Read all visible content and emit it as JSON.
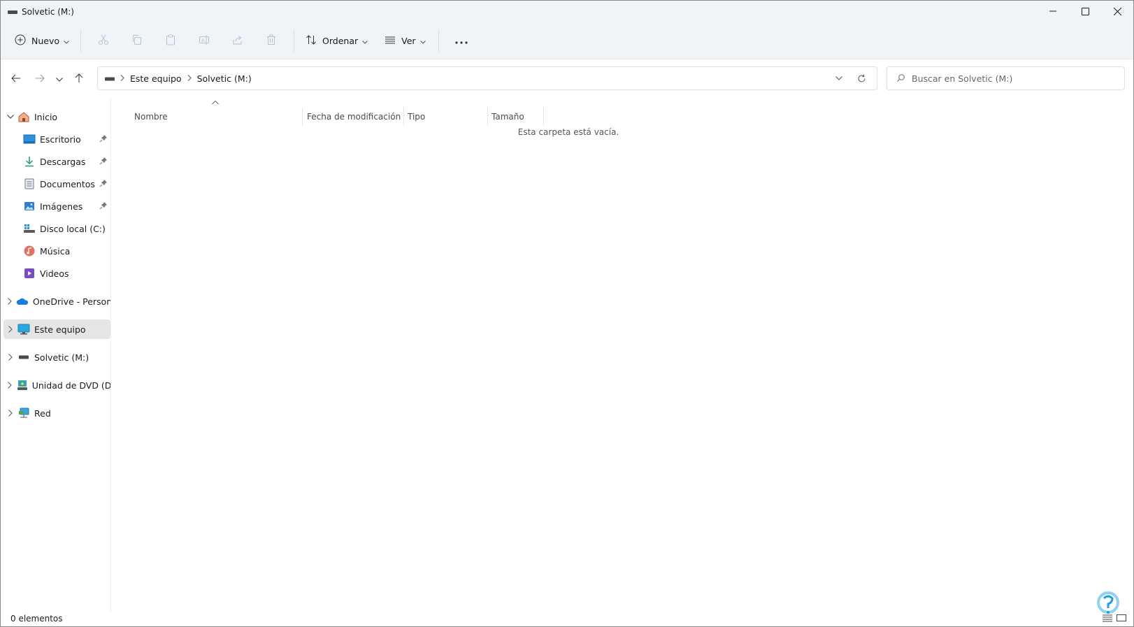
{
  "window": {
    "title": "Solvetic (M:)"
  },
  "toolbar": {
    "new_label": "Nuevo",
    "sort_label": "Ordenar",
    "view_label": "Ver"
  },
  "address": {
    "crumbs": [
      "Este equipo",
      "Solvetic (M:)"
    ]
  },
  "search": {
    "placeholder": "Buscar en Solvetic (M:)"
  },
  "sidebar": {
    "items": [
      {
        "label": "Inicio",
        "icon": "home-icon",
        "expanded": true
      },
      {
        "label": "Escritorio",
        "icon": "desktop-icon",
        "pinned": true
      },
      {
        "label": "Descargas",
        "icon": "download-icon",
        "pinned": true
      },
      {
        "label": "Documentos",
        "icon": "documents-icon",
        "pinned": true
      },
      {
        "label": "Imágenes",
        "icon": "pictures-icon",
        "pinned": true
      },
      {
        "label": "Disco local (C:)",
        "icon": "drive-icon"
      },
      {
        "label": "Música",
        "icon": "music-icon"
      },
      {
        "label": "Videos",
        "icon": "videos-icon"
      },
      {
        "label": "OneDrive - Personal",
        "icon": "onedrive-icon"
      },
      {
        "label": "Este equipo",
        "icon": "computer-icon",
        "selected": true
      },
      {
        "label": "Solvetic (M:)",
        "icon": "usb-drive-icon"
      },
      {
        "label": "Unidad de DVD (D:)",
        "icon": "dvd-icon"
      },
      {
        "label": "Red",
        "icon": "network-icon"
      }
    ]
  },
  "columns": {
    "name": "Nombre",
    "modified": "Fecha de modificación",
    "type": "Tipo",
    "size": "Tamaño"
  },
  "content": {
    "empty_message": "Esta carpeta está vacía."
  },
  "status": {
    "count": "0 elementos"
  },
  "colors": {
    "chrome": "#eff4f9",
    "selected": "#e5e5e5",
    "accent": "#0067c0"
  }
}
